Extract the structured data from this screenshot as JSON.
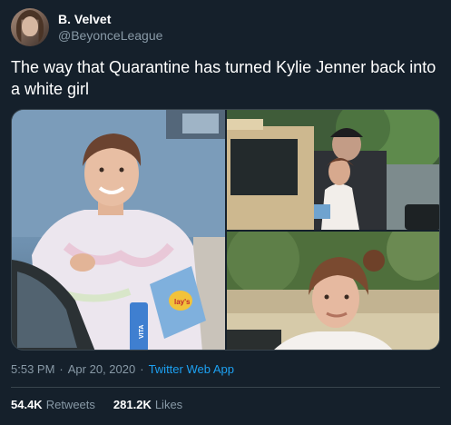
{
  "author": {
    "display_name": "B. Velvet",
    "handle": "@BeyonceLeague"
  },
  "tweet": {
    "text": "The way that Quarantine has turned Kylie Jenner back into a white girl",
    "time": "5:53 PM",
    "date": "Apr 20, 2020",
    "separator": "·",
    "source": "Twitter Web App"
  },
  "media": {
    "photos": [
      {
        "name": "photo-1"
      },
      {
        "name": "photo-2"
      },
      {
        "name": "photo-3"
      }
    ],
    "bag_text": "lay's",
    "bottle_text": "VITA"
  },
  "stats": {
    "retweets_value": "54.4K",
    "retweets_label": "Retweets",
    "likes_value": "281.2K",
    "likes_label": "Likes"
  },
  "colors": {
    "background": "#15202b",
    "text_primary": "#ffffff",
    "text_secondary": "#8899a6",
    "link": "#1da1f2",
    "border": "#38444d"
  }
}
